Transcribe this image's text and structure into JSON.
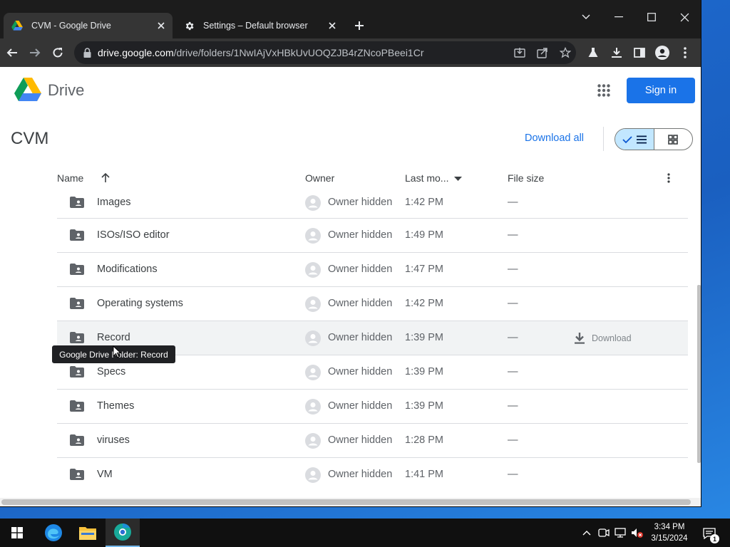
{
  "browser": {
    "tabs": [
      {
        "title": "CVM - Google Drive",
        "active": true,
        "icon": "google-drive-favicon"
      },
      {
        "title": "Settings – Default browser",
        "active": false,
        "icon": "gear-icon"
      }
    ],
    "url_host": "drive.google.com",
    "url_path": "/drive/folders/1NwIAjVxHBkUvUOQZJB4rZNcoPBeei1Cr"
  },
  "drive": {
    "app_name": "Drive",
    "sign_in_label": "Sign in",
    "folder_title": "CVM",
    "download_all_label": "Download all",
    "columns": {
      "name": "Name",
      "owner": "Owner",
      "modified": "Last mo...",
      "size": "File size"
    },
    "rows": [
      {
        "name": "Images",
        "owner": "Owner hidden",
        "modified": "1:42 PM",
        "size": "—"
      },
      {
        "name": "ISOs/ISO editor",
        "owner": "Owner hidden",
        "modified": "1:49 PM",
        "size": "—"
      },
      {
        "name": "Modifications",
        "owner": "Owner hidden",
        "modified": "1:47 PM",
        "size": "—"
      },
      {
        "name": "Operating systems",
        "owner": "Owner hidden",
        "modified": "1:42 PM",
        "size": "—"
      },
      {
        "name": "Record",
        "owner": "Owner hidden",
        "modified": "1:39 PM",
        "size": "—",
        "hover_action": "Download"
      },
      {
        "name": "Specs",
        "owner": "Owner hidden",
        "modified": "1:39 PM",
        "size": "—"
      },
      {
        "name": "Themes",
        "owner": "Owner hidden",
        "modified": "1:39 PM",
        "size": "—"
      },
      {
        "name": "viruses",
        "owner": "Owner hidden",
        "modified": "1:28 PM",
        "size": "—"
      },
      {
        "name": "VM",
        "owner": "Owner hidden",
        "modified": "1:41 PM",
        "size": "—"
      }
    ],
    "tooltip": "Google Drive Folder: Record"
  },
  "taskbar": {
    "time": "3:34 PM",
    "date": "3/15/2024",
    "notification_count": "1"
  },
  "colors": {
    "accent": "#1a73e8",
    "toggle_active": "#c2e7ff",
    "tab_strip": "#1c1c1c",
    "toolbar": "#353535"
  }
}
